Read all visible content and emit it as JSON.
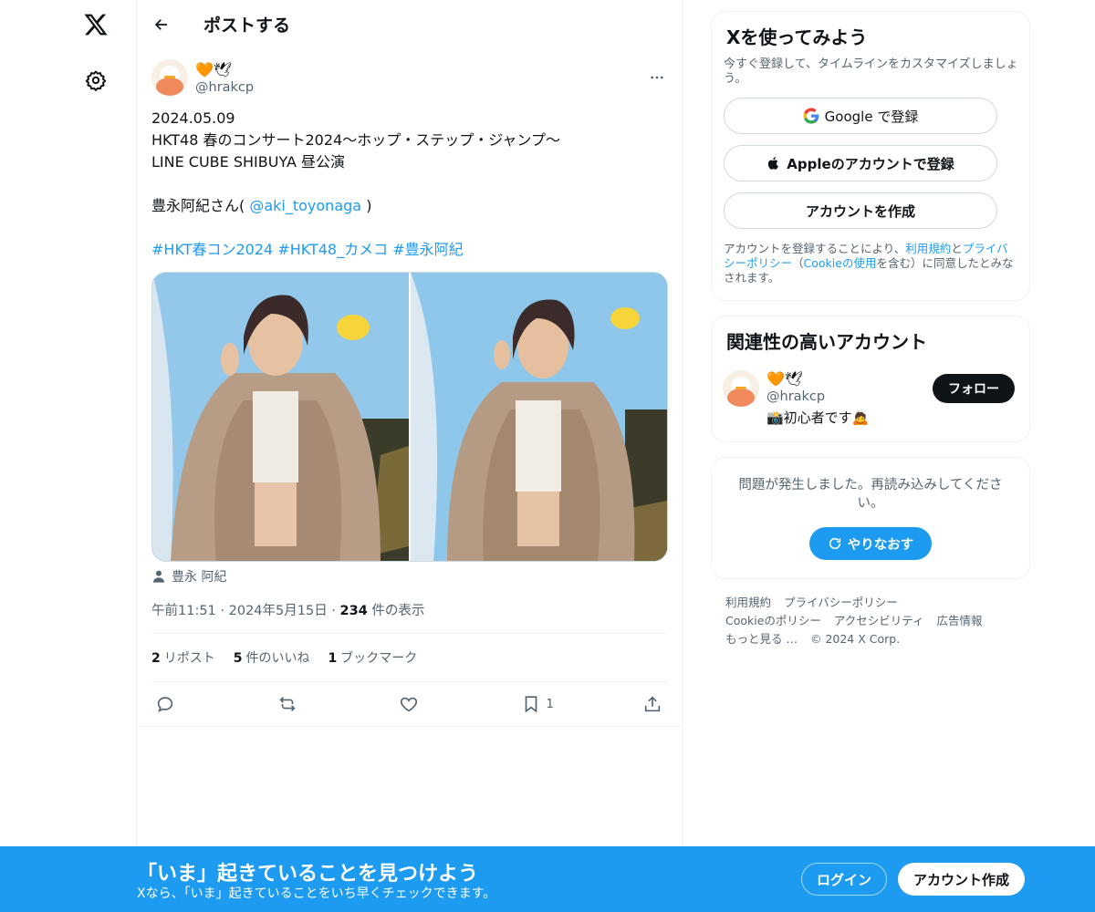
{
  "nav": {
    "logo_icon": "x-logo-icon",
    "settings_icon": "gear-icon"
  },
  "header": {
    "title": "ポストする",
    "back_icon": "arrow-left-icon"
  },
  "post": {
    "author_name": "🧡🕊",
    "author_handle": "@hrakcp",
    "text_lines": [
      "2024.05.09",
      "HKT48 春のコンサート2024〜ホップ・ステップ・ジャンプ〜",
      "LINE CUBE SHIBUYA 昼公演"
    ],
    "mention_prefix": "豊永阿紀さん(",
    "mention": "@aki_toyonaga",
    "mention_suffix": ")",
    "hashtags": [
      "#HKT春コン2024",
      "#HKT48_カメコ",
      "#豊永阿紀"
    ],
    "tagged_person": "豊永 阿紀",
    "time": "午前11:51",
    "date": "2024年5月15日",
    "views_count": "234",
    "views_label": "件の表示",
    "stats": {
      "reposts_count": "2",
      "reposts_label": "リポスト",
      "likes_count": "5",
      "likes_label": "件のいいね",
      "bookmarks_count": "1",
      "bookmarks_label": "ブックマーク"
    },
    "actions": {
      "bookmark_count": "1"
    }
  },
  "signup_card": {
    "title": "Xを使ってみよう",
    "subtitle": "今すぐ登録して、タイムラインをカスタマイズしましょう。",
    "google_label": "Google で登録",
    "apple_label": "Appleのアカウントで登録",
    "create_label": "アカウントを作成",
    "terms_prefix": "アカウントを登録することにより、",
    "terms_link": "利用規約",
    "terms_and": "と",
    "privacy_link": "プライバシーポリシー",
    "terms_mid": "（",
    "cookie_link": "Cookieの使用",
    "terms_suffix": "を含む）に同意したとみなされます。"
  },
  "related_card": {
    "title": "関連性の高いアカウント",
    "name": "🧡🕊",
    "handle": "@hrakcp",
    "bio": "📸初心者です🙇",
    "follow_label": "フォロー"
  },
  "error_card": {
    "message": "問題が発生しました。再読み込みしてください。",
    "retry_label": "やりなおす"
  },
  "footer": {
    "row1": [
      "利用規約",
      "プライバシーポリシー"
    ],
    "row2": [
      "Cookieのポリシー",
      "アクセシビリティ",
      "広告情報"
    ],
    "more": "もっと見る …",
    "copyright": "© 2024 X Corp."
  },
  "banner": {
    "title": "「いま」起きていることを見つけよう",
    "subtitle": "Xなら、「いま」起きていることをいち早くチェックできます。",
    "login_label": "ログイン",
    "signup_label": "アカウント作成"
  },
  "colors": {
    "accent": "#1d9bf0",
    "text": "#0f1419",
    "muted": "#536471",
    "border": "#eff3f4"
  }
}
